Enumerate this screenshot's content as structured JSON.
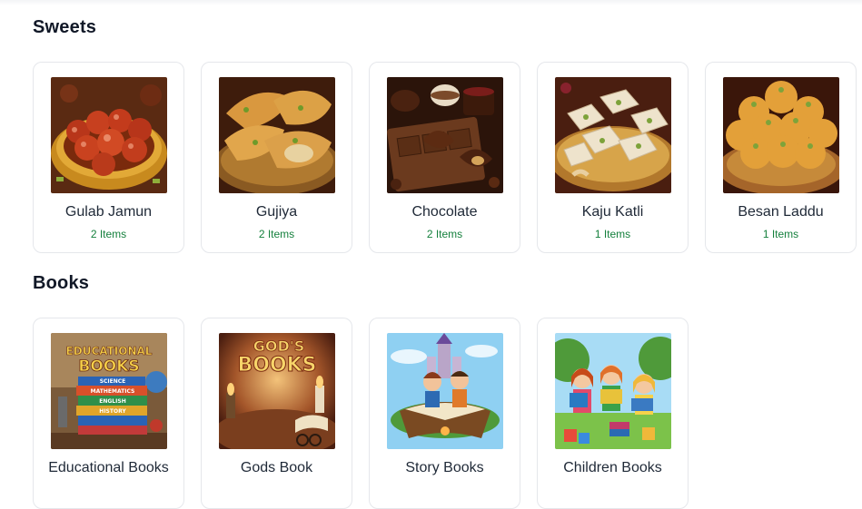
{
  "sections": [
    {
      "title": "Sweets",
      "items": [
        {
          "name": "Gulab Jamun",
          "count": "2 Items",
          "icon": "gulab-jamun-image"
        },
        {
          "name": "Gujiya",
          "count": "2 Items",
          "icon": "gujiya-image"
        },
        {
          "name": "Chocolate",
          "count": "2 Items",
          "icon": "chocolate-image"
        },
        {
          "name": "Kaju Katli",
          "count": "1 Items",
          "icon": "kaju-katli-image"
        },
        {
          "name": "Besan Laddu",
          "count": "1 Items",
          "icon": "besan-laddu-image"
        }
      ]
    },
    {
      "title": "Books",
      "items": [
        {
          "name": "Educational Books",
          "icon": "educational-books-image",
          "art_text": [
            "EDUCATIONAL",
            "BOOKS",
            "SCIENCE",
            "MATHEMATICS",
            "ENGLISH",
            "HISTORY"
          ]
        },
        {
          "name": "Gods Book",
          "icon": "gods-book-image",
          "art_text": [
            "GOD'S",
            "BOOKS"
          ]
        },
        {
          "name": "Story Books",
          "icon": "story-books-image"
        },
        {
          "name": "Children Books",
          "icon": "children-books-image"
        }
      ]
    }
  ],
  "colors": {
    "accent_count": "#15803d",
    "card_border": "#e5e7eb",
    "title": "#111827"
  }
}
